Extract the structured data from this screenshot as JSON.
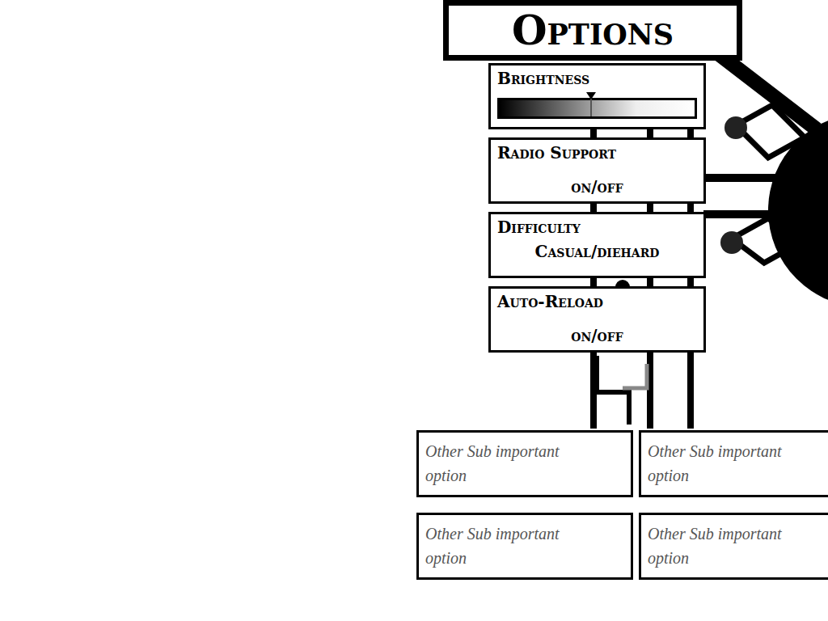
{
  "title": "Options",
  "options": [
    {
      "kind": "slider",
      "label": "Brightness",
      "level": 0.47
    },
    {
      "kind": "toggle",
      "label": "Radio Support",
      "value": "on/off"
    },
    {
      "kind": "toggle",
      "label": "Difficulty",
      "value": "Casual/diehard"
    },
    {
      "kind": "toggle",
      "label": "Auto-Reload",
      "value": "on/off"
    }
  ],
  "sub_options": [
    {
      "label": "Other Sub important option"
    },
    {
      "label": "Other Sub important option"
    },
    {
      "label": "Other Sub important option"
    },
    {
      "label": "Other Sub important option"
    }
  ]
}
